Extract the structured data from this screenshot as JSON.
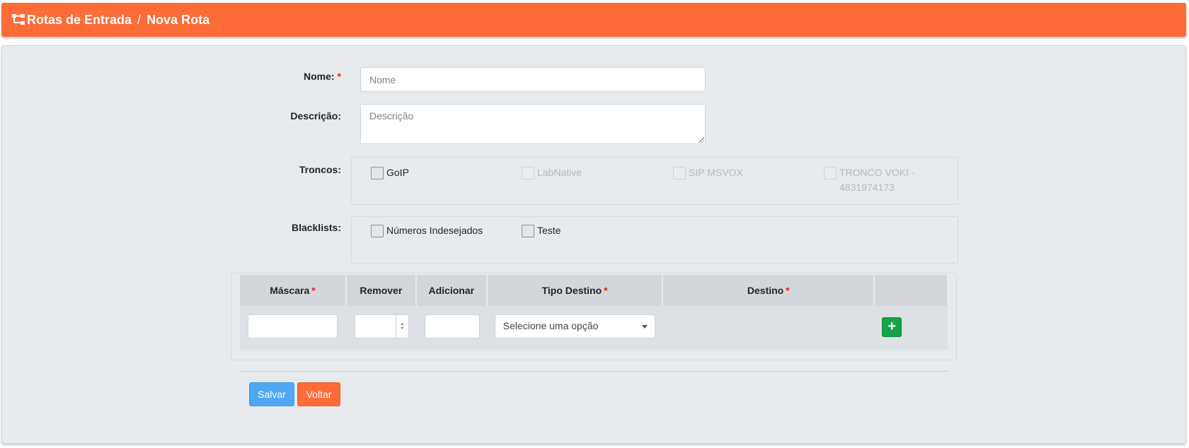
{
  "header": {
    "breadcrumb_root": "Rotas de Entrada",
    "separator": "/",
    "breadcrumb_current": "Nova Rota",
    "bg_color": "#ff6c37"
  },
  "form": {
    "name_label": "Nome:",
    "name_required": "*",
    "name_placeholder": "Nome",
    "name_value": "",
    "description_label": "Descrição:",
    "description_placeholder": "Descrição",
    "description_value": "",
    "trunks_label": "Troncos:",
    "trunks": [
      {
        "label": "GoIP",
        "checked": false,
        "disabled": false
      },
      {
        "label": "LabNative",
        "checked": false,
        "disabled": true
      },
      {
        "label": "SIP MSVOX",
        "checked": false,
        "disabled": true
      },
      {
        "label": "TRONCO VOKI - 4831974173",
        "checked": false,
        "disabled": true
      }
    ],
    "blacklists_label": "Blacklists:",
    "blacklists": [
      {
        "label": "Números Indesejados",
        "checked": false
      },
      {
        "label": "Teste",
        "checked": false
      }
    ]
  },
  "rules_table": {
    "headers": {
      "mask": "Máscara",
      "remove": "Remover",
      "add": "Adicionar",
      "dest_type": "Tipo Destino",
      "destination": "Destino",
      "required": "*"
    },
    "row": {
      "mask_value": "",
      "remove_value": "",
      "add_value": "",
      "dest_type_selected": "Selecione uma opção",
      "add_row_label": "+"
    }
  },
  "actions": {
    "save_label": "Salvar",
    "back_label": "Voltar",
    "save_color": "#4fa8f2",
    "back_color": "#ff6c37"
  }
}
